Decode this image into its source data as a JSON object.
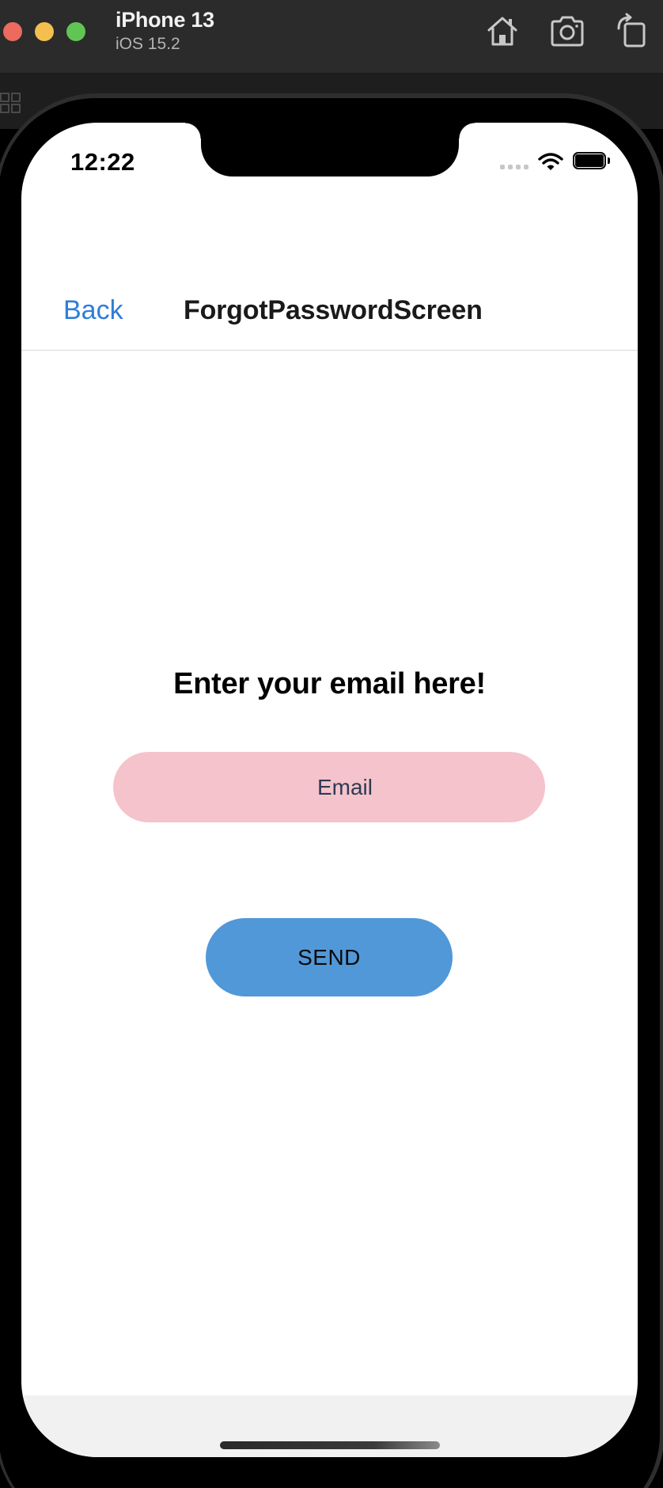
{
  "simulator": {
    "device_name": "iPhone 13",
    "os_version": "iOS 15.2",
    "toolbar_icons": [
      "home-icon",
      "screenshot-icon",
      "rotate-icon"
    ]
  },
  "status_bar": {
    "time": "12:22"
  },
  "nav": {
    "back_label": "Back",
    "title": "ForgotPasswordScreen"
  },
  "content": {
    "heading": "Enter your email here!",
    "email_placeholder": "Email",
    "email_value": "",
    "send_label": "SEND"
  },
  "colors": {
    "accent_link": "#2f7ed8",
    "input_background": "#f5c3cb",
    "button_background": "#5198d8"
  }
}
